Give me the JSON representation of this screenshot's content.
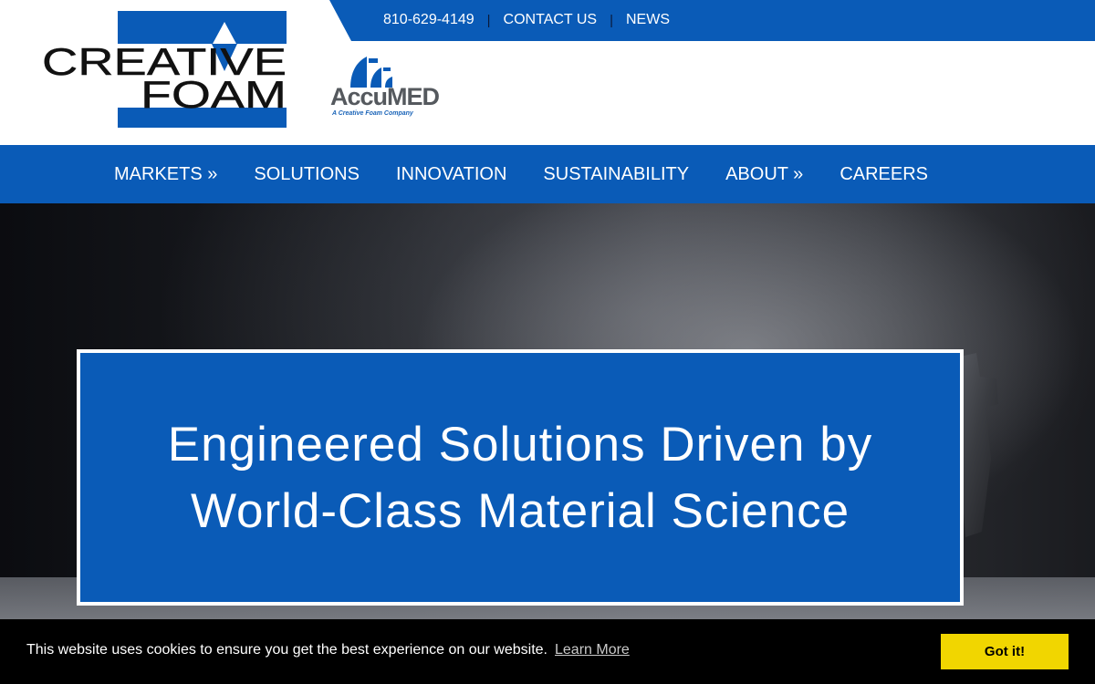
{
  "header": {
    "utility_links": [
      {
        "label": "810-629-4149"
      },
      {
        "label": "CONTACT US"
      },
      {
        "label": "NEWS"
      }
    ],
    "separator": "|",
    "logo_primary": {
      "line1": "CREATIVE",
      "line2": "FOAM"
    },
    "logo_secondary": {
      "wordmark": "AccuMED",
      "tagline": "A Creative Foam Company"
    }
  },
  "nav": {
    "items": [
      {
        "label": "MARKETS »"
      },
      {
        "label": "SOLUTIONS"
      },
      {
        "label": "INNOVATION"
      },
      {
        "label": "SUSTAINABILITY"
      },
      {
        "label": "ABOUT »"
      },
      {
        "label": "CAREERS"
      }
    ]
  },
  "hero": {
    "heading": "Engineered Solutions Driven by World-Class Material Science"
  },
  "cookie": {
    "message": "This website uses cookies to ensure you get the best experience on our website.",
    "learn_more": "Learn More",
    "accept": "Got it!"
  },
  "colors": {
    "brand_blue": "#0a5bb7",
    "cookie_button": "#f1d600",
    "cookie_background": "#000000"
  }
}
